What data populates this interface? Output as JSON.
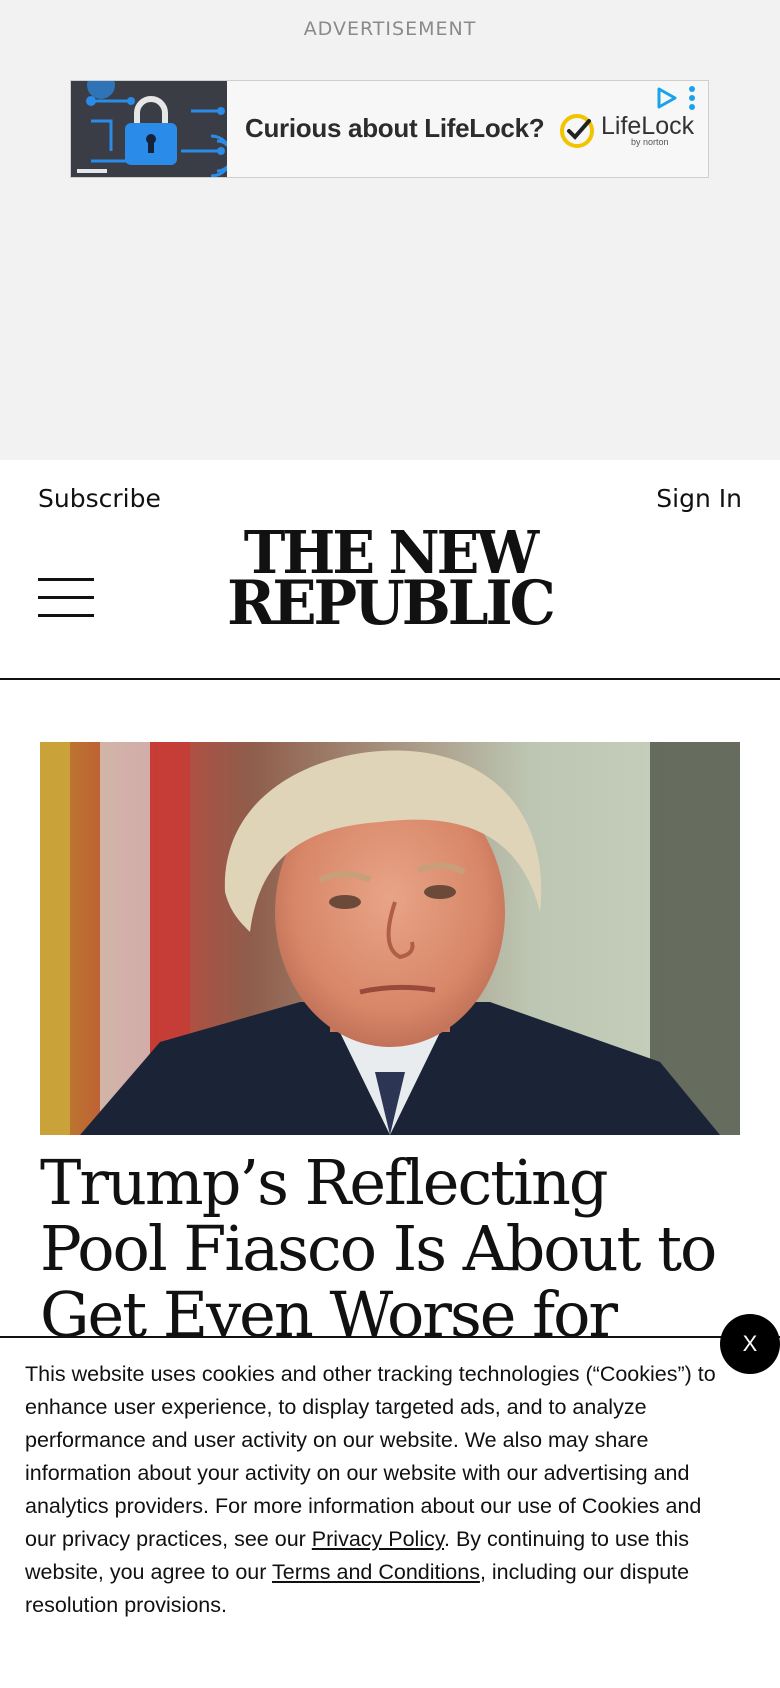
{
  "ad": {
    "label": "ADVERTISEMENT",
    "headline": "Curious about LifeLock?",
    "brand": "LifeLock",
    "brand_sub": "by norton",
    "icons": [
      "lock-icon",
      "check-icon",
      "adchoices-icon",
      "more-vertical-icon"
    ]
  },
  "header": {
    "subscribe": "Subscribe",
    "sign_in": "Sign In",
    "logo_line1": "THE NEW",
    "logo_line2": "REPUBLIC",
    "menu_icon": "hamburger-menu-icon"
  },
  "article": {
    "headline": "Trump’s Reflecting Pool Fiasco Is About to Get Even Worse for Him"
  },
  "cookie_banner": {
    "text_before_privacy": "This website uses cookies and other tracking technologies (“Cookies”) to enhance user experience, to display targeted ads, and to analyze performance and user activity on our website. We also may share information about your activity on our website with our advertising and analytics providers. For more information about our use of Cookies and our privacy practices, see our ",
    "privacy_link": "Privacy Policy",
    "text_between": ". By continuing to use this website, you agree to our ",
    "terms_link": "Terms and Conditions",
    "text_after": ", including our dispute resolution provisions.",
    "close_label": "X"
  },
  "colors": {
    "ad_background": "#f2f2f2",
    "ad_label": "#8a8a8a",
    "text": "#111111",
    "close_button": "#000000",
    "lock_blue": "#2a8be8",
    "check_yellow": "#f2c400",
    "adchoices_blue": "#1aa3e8"
  }
}
